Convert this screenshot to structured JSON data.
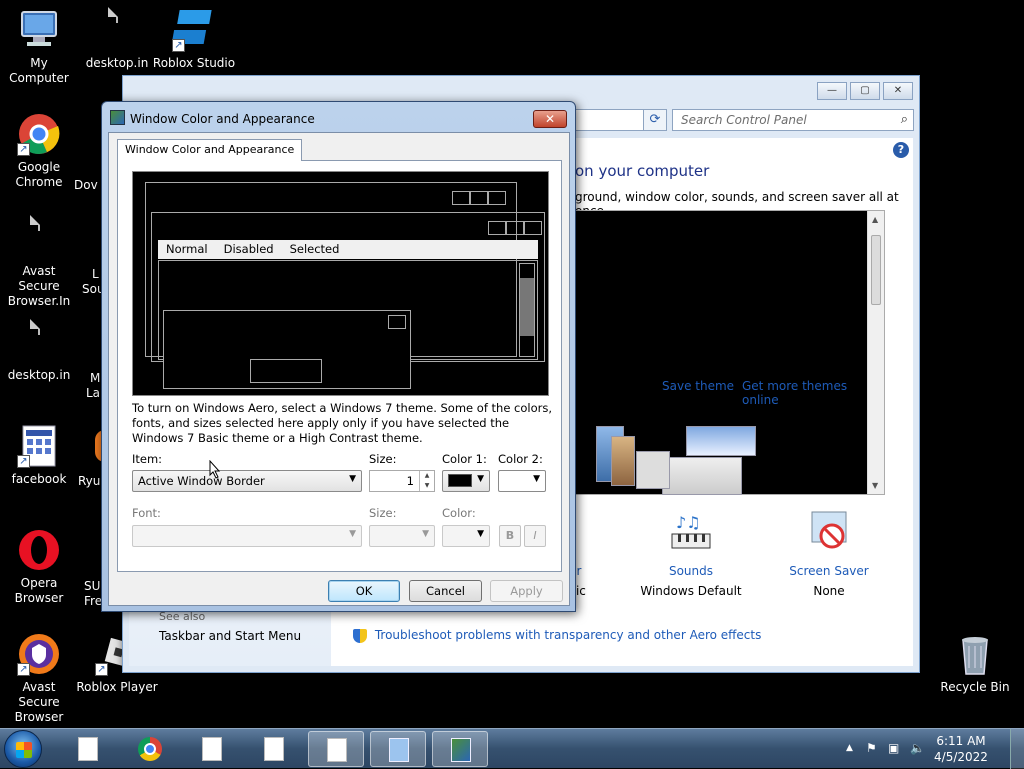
{
  "desktop": {
    "icons": [
      {
        "id": "my-computer",
        "label": "My Computer",
        "glyph": "computer-icon"
      },
      {
        "id": "desktop-ini-1",
        "label": "desktop.in",
        "glyph": "file-icon"
      },
      {
        "id": "roblox-studio",
        "label": "Roblox Studio",
        "glyph": "roblox-studio-icon"
      },
      {
        "id": "google-chrome",
        "label": "Google Chrome",
        "glyph": "chrome-icon"
      },
      {
        "id": "avast-secure-browser-in",
        "label": "Avast Secure Browser.In",
        "glyph": "file-icon"
      },
      {
        "id": "desktop-ini-2",
        "label": "desktop.in",
        "glyph": "file-icon"
      },
      {
        "id": "facebook",
        "label": "facebook",
        "glyph": "shortcut-page-icon"
      },
      {
        "id": "opera-browser",
        "label": "Opera Browser",
        "glyph": "opera-icon"
      },
      {
        "id": "avast-secure-browser",
        "label": "Avast Secure Browser",
        "glyph": "avast-icon"
      },
      {
        "id": "roblox-player",
        "label": "Roblox Player",
        "glyph": "roblox-player-icon"
      },
      {
        "id": "recycle-bin",
        "label": "Recycle Bin",
        "glyph": "recycle-bin-icon"
      }
    ],
    "partial_labels": {
      "dov": "Dov",
      "l": "L",
      "sou": "Sou",
      "m": "M",
      "lar": "Lar",
      "ryu": "Ryu",
      "su": "SU",
      "fre": "Fre"
    }
  },
  "control_panel": {
    "search_placeholder": "Search Control Panel",
    "heading_partial": "on your computer",
    "subtitle_partial": "ground, window color, sounds, and screen saver all at once.",
    "save_theme": "Save theme",
    "get_more_themes": "Get more themes online",
    "bottom_items": [
      {
        "title_partial": "olor",
        "value_partial": "Basic"
      },
      {
        "title": "Sounds",
        "value": "Windows Default"
      },
      {
        "title": "Screen Saver",
        "value": "None"
      }
    ],
    "see_also": "See also",
    "taskbar_start_menu": "Taskbar and Start Menu",
    "troubleshoot_link": "Troubleshoot problems with transparency and other Aero effects"
  },
  "dialog": {
    "title": "Window Color and Appearance",
    "tab": "Window Color and Appearance",
    "preview_menu": [
      "Normal",
      "Disabled",
      "Selected"
    ],
    "description": "To turn on Windows Aero, select a Windows 7 theme.  Some of the colors, fonts, and sizes selected here apply only if you have selected the Windows 7 Basic theme or a High Contrast theme.",
    "item_label": "Item:",
    "item_value": "Active Window Border",
    "size_label": "Size:",
    "size_value": "1",
    "color1_label": "Color 1:",
    "color2_label": "Color 2:",
    "font_label": "Font:",
    "font_size_label": "Size:",
    "font_color_label": "Color:",
    "bold_label": "B",
    "italic_label": "I",
    "ok": "OK",
    "cancel": "Cancel",
    "apply": "Apply",
    "color1_value": "#000000"
  },
  "taskbar": {
    "time": "6:11 AM",
    "date": "4/5/2022"
  }
}
